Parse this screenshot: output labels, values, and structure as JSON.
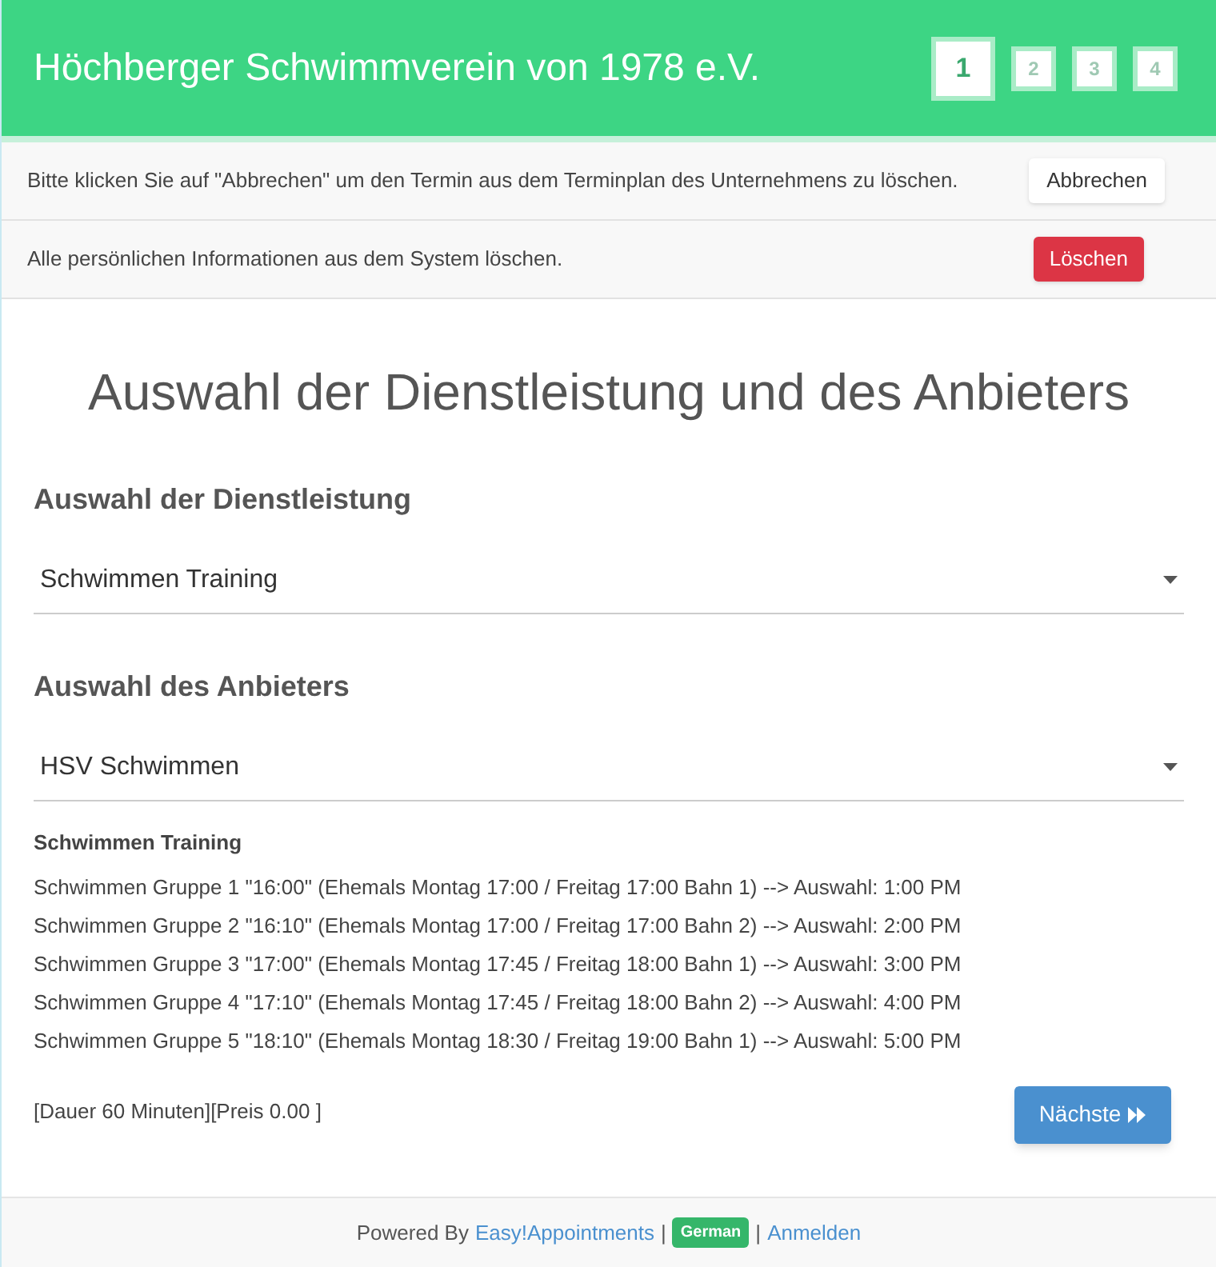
{
  "header": {
    "title": "Höchberger Schwimmverein von 1978 e.V.",
    "steps": [
      {
        "label": "1",
        "selected": true
      },
      {
        "label": "2",
        "selected": false
      },
      {
        "label": "3",
        "selected": false
      },
      {
        "label": "4",
        "selected": false
      }
    ]
  },
  "notices": [
    {
      "text": "Bitte klicken Sie auf \"Abbrechen\" um den Termin aus dem Terminplan des Unternehmens zu löschen.",
      "button": "Abbrechen",
      "kind": "default"
    },
    {
      "text": "Alle persönlichen Informationen aus dem System löschen.",
      "button": "Löschen",
      "kind": "danger"
    }
  ],
  "heading": "Auswahl der Dienstleistung und des Anbieters",
  "selects": [
    {
      "label": "Auswahl der Dienstleistung",
      "value": "Schwimmen Training"
    },
    {
      "label": "Auswahl des Anbieters",
      "value": "HSV Schwimmen"
    }
  ],
  "description": {
    "title": "Schwimmen Training",
    "lines": [
      "Schwimmen Gruppe 1 \"16:00\" (Ehemals Montag 17:00 / Freitag 17:00 Bahn 1) --> Auswahl: 1:00 PM",
      "Schwimmen Gruppe 2 \"16:10\" (Ehemals Montag 17:00 / Freitag 17:00 Bahn 2) --> Auswahl: 2:00 PM",
      "Schwimmen Gruppe 3 \"17:00\" (Ehemals Montag 17:45 / Freitag 18:00 Bahn 1) --> Auswahl: 3:00 PM",
      "Schwimmen Gruppe 4 \"17:10\" (Ehemals Montag 17:45 / Freitag 18:00 Bahn 2) --> Auswahl: 4:00 PM",
      "Schwimmen Gruppe 5 \"18:10\" (Ehemals Montag 18:30 / Freitag 19:00 Bahn 1) --> Auswahl: 5:00 PM"
    ]
  },
  "details": "[Dauer 60 Minuten][Preis 0.00 ]",
  "next_button": "Nächste",
  "footer": {
    "powered_by": "Powered By",
    "link": "Easy!Appointments",
    "separator_1": "|",
    "language": "German",
    "separator_2": "|",
    "login": "Anmelden"
  }
}
